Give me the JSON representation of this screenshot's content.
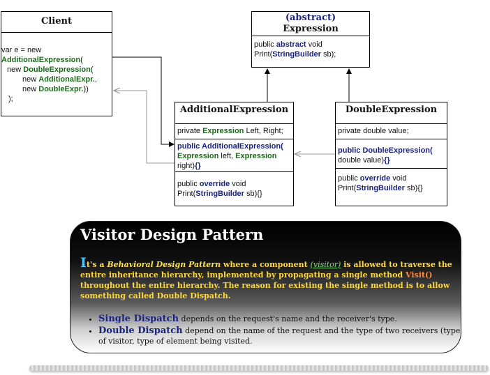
{
  "client": {
    "title": "Client",
    "code": {
      "l1": "var e = new",
      "l2": "AdditionalExpression",
      "l2b": "(",
      "l3a": "new ",
      "l3b": "DoubleExpression",
      "l3c": "(",
      "l4a": "new ",
      "l4b": "AdditionalExpr.",
      "l4c": ",",
      "l5a": "new ",
      "l5b": "DoubleExpr.",
      "l5c": "))",
      "l6": ");"
    }
  },
  "expression": {
    "title_abstract": "(abstract)",
    "title_name": "Expression",
    "m1": "public ",
    "m1kw": "abstract",
    "m1b": " void",
    "m2": "Print(",
    "m2ty": "StringBuilder",
    "m2b": " sb);"
  },
  "additional": {
    "title": "AdditionalExpression",
    "f1": "private ",
    "f1ty": "Expression",
    "f1b": " Left, Right;",
    "c1": "public AdditionalExpression(",
    "c2ty": "Expression",
    "c2": " left, ",
    "c2ty2": "Expression",
    "c3": "right)",
    "c3b": "{}",
    "p1": "public ",
    "p1kw": "override",
    "p1b": " void",
    "p2": "Print(",
    "p2ty": "StringBuilder",
    "p2b": " sb){}"
  },
  "double": {
    "title": "DoubleExpression",
    "f1": "private double value;",
    "c1": "public DoubleExpression(",
    "c2": "double value)",
    "c2b": "{}",
    "p1": "public ",
    "p1kw": "override",
    "p1b": " void",
    "p2": "Print(",
    "p2ty": "StringBuilder",
    "p2b": " sb){}"
  },
  "panel": {
    "title": "Visitor Design Pattern",
    "dropcap": "I",
    "t1": "t's a ",
    "t2": "Behavioral Design Pattern",
    "t3": " where a component ",
    "t4": "(visitor)",
    "t5": " is allowed to traverse the entire inheritance hierarchy, implemented by propagating a single method  ",
    "t6": "Visit()",
    "t7": " throughout the entire hierarchy.  The reason for existing the single method is to allow something called Double Dispatch.",
    "b1term": "Single Dispatch",
    "b1text": " depends on the request's name and the receiver's type.",
    "b2term": "Double Dispatch",
    "b2text": " depend on the name of the request and the type of two receivers (type of visitor, type of element being visited."
  },
  "colors": {
    "keyword": "#1a237e",
    "type": "#1b6b1b",
    "panel_text": "#ffd83a",
    "dropcap": "#4fc3f7",
    "visitor_link": "#7fe07f",
    "visit_method": "#ff8a3d"
  }
}
